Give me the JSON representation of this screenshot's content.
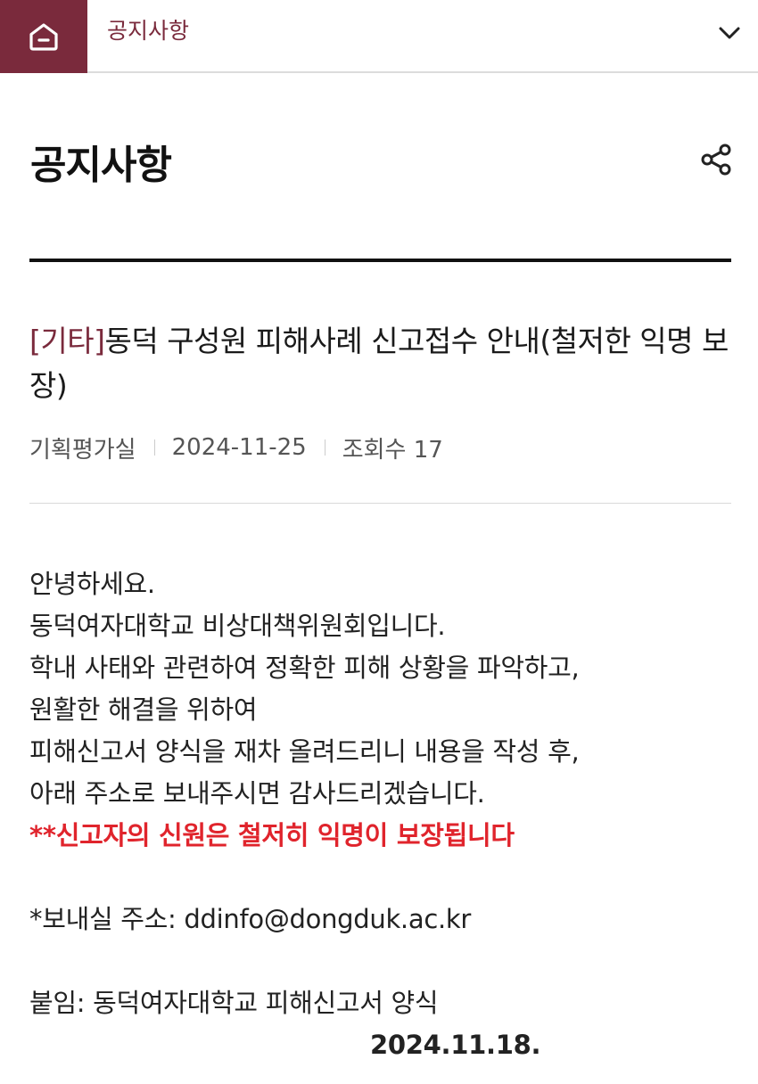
{
  "nav": {
    "title": "공지사항"
  },
  "header": {
    "page_title": "공지사항"
  },
  "post": {
    "category": "[기타]",
    "title": "동덕 구성원 피해사례 신고접수 안내(철저한 익명 보장)",
    "author": "기획평가실",
    "date": "2024-11-25",
    "views_label": "조회수 17"
  },
  "body": {
    "lines": [
      "안녕하세요.",
      "동덕여자대학교 비상대책위원회입니다.",
      "학내 사태와 관련하여 정확한 피해 상황을 파악하고,",
      "원활한 해결을 위하여",
      "피해신고서 양식을 재차 올려드리니 내용을 작성 후,",
      "아래 주소로 보내주시면 감사드리겠습니다."
    ],
    "emphasis": "**신고자의 신원은 철저히 익명이 보장됩니다",
    "address": "*보내실 주소: ddinfo@dongduk.ac.kr",
    "attachment": "붙임: 동덕여자대학교 피해신고서 양식",
    "sign_date": "2024.11.18."
  },
  "icons": {
    "home": "home-icon",
    "chevron": "chevron-down-icon",
    "share": "share-icon"
  },
  "colors": {
    "brand": "#7a2a3c",
    "emphasis": "#e0242c"
  }
}
